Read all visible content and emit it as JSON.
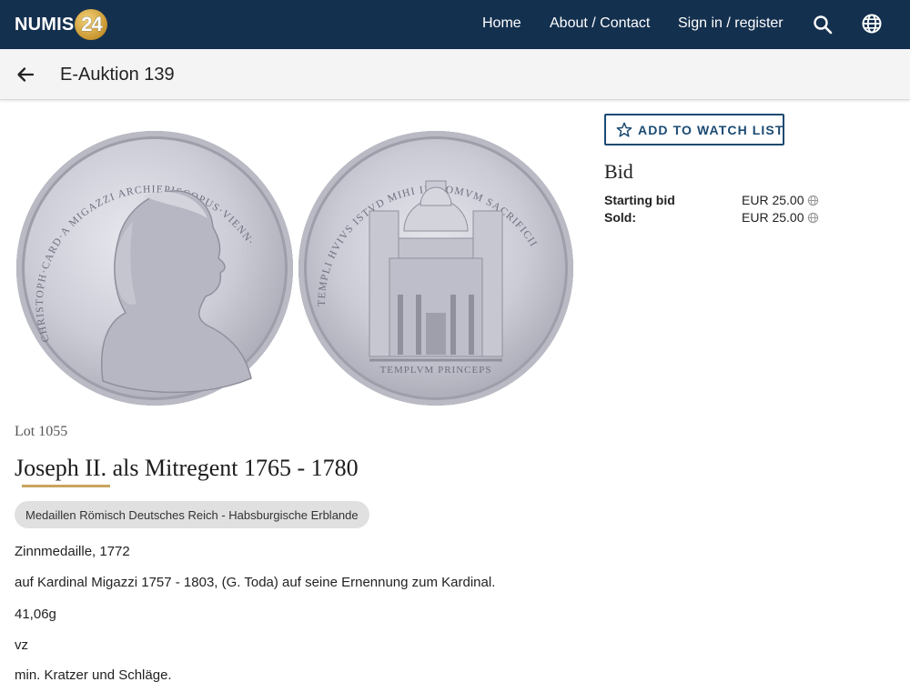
{
  "brand": {
    "logo_text": "NUMIS",
    "logo_badge": "24"
  },
  "nav": {
    "home": "Home",
    "about": "About / Contact",
    "sign_in": "Sign in / register",
    "search_icon": "search-icon",
    "language_icon": "globe-icon"
  },
  "subheader": {
    "back_icon": "arrow-left-icon",
    "title": "E-Auktion 139"
  },
  "coins": {
    "obverse_inscription": "CHRISTOPH·CARD·A MIGAZZI ARCHIEPISCOPUS·VIENN·",
    "reverse_inscription": "TEMPLVM PRINCEPS"
  },
  "watch": {
    "label": "ADD TO WATCH LIST",
    "icon": "star-icon"
  },
  "bid": {
    "heading": "Bid",
    "starting_label": "Starting bid",
    "starting_value": "EUR 25.00",
    "sold_label": "Sold:",
    "sold_value": "EUR 25.00"
  },
  "lot": {
    "number": "Lot 1055",
    "title": "Joseph II. als Mitregent 1765 - 1780",
    "category": "Medaillen Römisch Deutsches Reich - Habsburgische Erblande",
    "description": [
      "Zinnmedaille, 1772",
      "auf Kardinal Migazzi 1757 - 1803, (G. Toda) auf seine Ernennung zum Kardinal.",
      "41,06g",
      "vz",
      "min. Kratzer und Schläge."
    ]
  },
  "colors": {
    "nav_bg": "#14304f",
    "accent_gold": "#c9a45c",
    "button_border": "#1b4a72"
  }
}
